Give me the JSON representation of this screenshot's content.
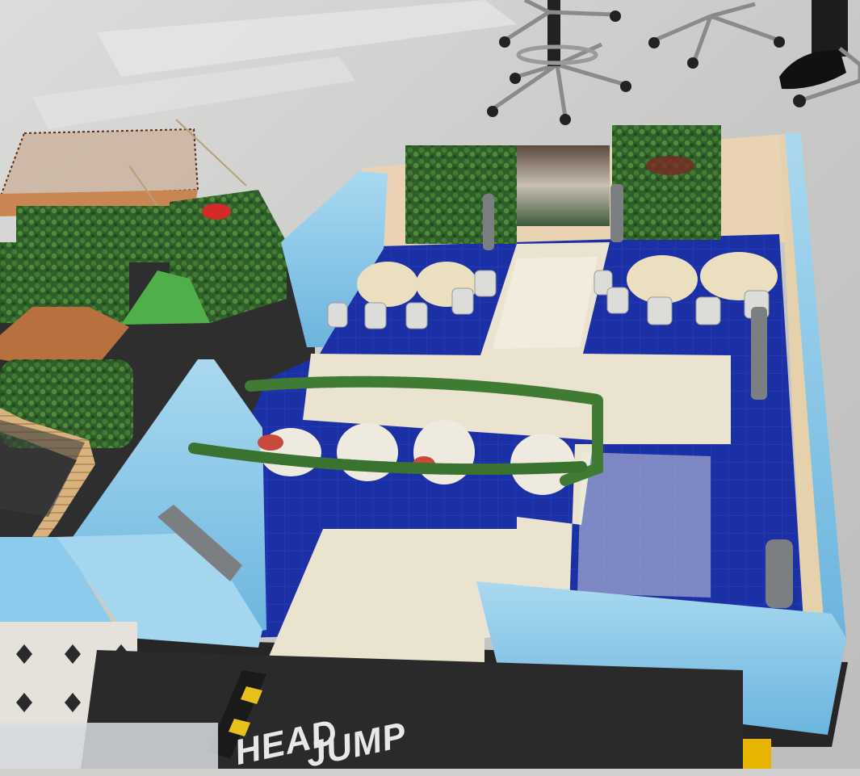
{
  "photo": {
    "floor_marking_words": [
      "HEAD",
      "JUMP"
    ]
  },
  "colors": {
    "floor": "#cfcfcd",
    "foam_wall": "#7fc3e6",
    "blue_mat": "#1a2fa8",
    "cream_path": "#e9e3cf",
    "hedge": "#2f6a2c",
    "back_wall": "#e9d3b2",
    "dark_mat": "#2b2b2b"
  }
}
